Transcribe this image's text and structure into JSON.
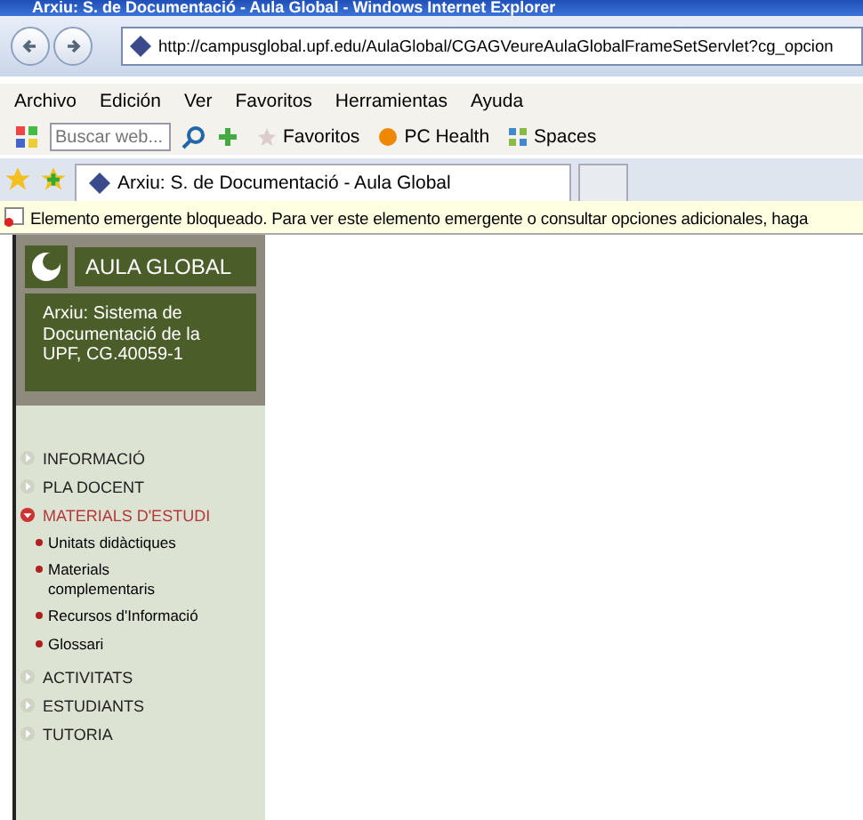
{
  "window": {
    "title": "Arxiu: S. de Documentació - Aula Global - Windows Internet Explorer"
  },
  "address_bar": {
    "url": "http://campusglobal.upf.edu/AulaGlobal/CGAGVeureAulaGlobalFrameSetServlet?cg_opcion"
  },
  "menu_bar": [
    "Archivo",
    "Edición",
    "Ver",
    "Favoritos",
    "Herramientas",
    "Ayuda"
  ],
  "toolbar": {
    "search": {
      "placeholder": "Buscar web..."
    },
    "items": [
      "Favoritos",
      "PC Health",
      "Spaces"
    ]
  },
  "tabs": [
    {
      "label": "Arxiu: S. de Documentació - Aula Global",
      "selected": true
    }
  ],
  "info_bar": {
    "text": "Elemento emergente bloqueado. Para ver este elemento emergente o consultar opciones adicionales, haga"
  },
  "sidebar": {
    "logo": "AULA GLOBAL",
    "subject": "Arxiu: Sistema de Documentació de la UPF, CG.40059-1",
    "items": [
      {
        "label": "INFORMACIÓ",
        "expanded": false
      },
      {
        "label": "PLA DOCENT",
        "expanded": false
      },
      {
        "label": "MATERIALS D'ESTUDI",
        "expanded": true,
        "children": [
          {
            "label": "Unitats didàctiques"
          },
          {
            "label": "Materials complementaris"
          },
          {
            "label": "Recursos d'Informació"
          },
          {
            "label": "Glossari"
          }
        ]
      },
      {
        "label": "ACTIVITATS",
        "expanded": false
      },
      {
        "label": "ESTUDIANTS",
        "expanded": false
      },
      {
        "label": "TUTORIA",
        "expanded": false
      }
    ]
  }
}
